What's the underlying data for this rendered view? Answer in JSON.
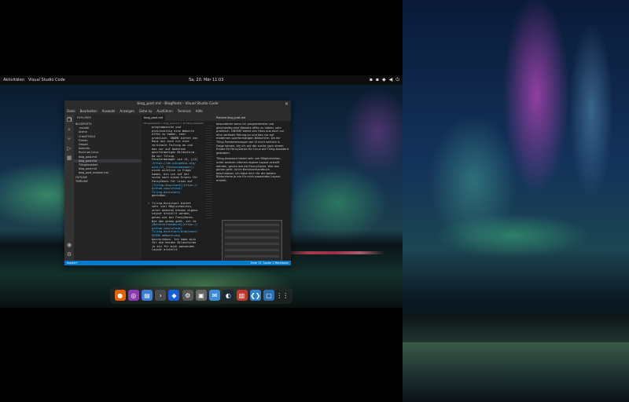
{
  "topbar": {
    "activities": "Aktivitäten",
    "app_name": "Visual Studio Code",
    "clock": "Sa, 20. Mär 11:03"
  },
  "window": {
    "title": "blog_post.md - BlogPosts - Visual Studio Code"
  },
  "menubar": [
    "Datei",
    "Bearbeiten",
    "Auswahl",
    "Anzeigen",
    "Gehe zu",
    "Ausführen",
    "Terminal",
    "Hilfe"
  ],
  "sidebar": {
    "title": "EXPLORER",
    "items": [
      {
        "label": "BLOGPOSTS",
        "selected": false
      },
      {
        "label": ".vscode",
        "selected": false
      },
      {
        "label": "Anime",
        "selected": false
      },
      {
        "label": "CrashTOOLS",
        "selected": false
      },
      {
        "label": "Firmen",
        "selected": false
      },
      {
        "label": "Gaspel",
        "selected": false
      },
      {
        "label": "Kubuntu",
        "selected": false
      },
      {
        "label": "Rund um Linux",
        "selected": false
      },
      {
        "label": "blog_post.md",
        "selected": false
      },
      {
        "label": "blog_post.md",
        "selected": true
      },
      {
        "label": "TilingAssistant",
        "selected": false
      },
      {
        "label": "blog_post.md",
        "selected": false
      },
      {
        "label": "blog_post_modern.md",
        "selected": false
      },
      {
        "label": "OUTLINE",
        "selected": false
      },
      {
        "label": "TIMELINE",
        "selected": false
      }
    ]
  },
  "editor": {
    "tab": "blog_post.md",
    "breadcrumb": "Tilingassistant > blog_post.md > # Tiling-Assistant",
    "lines": [
      {
        "n": "",
        "text": "programmieren und",
        "link": false
      },
      {
        "n": "",
        "text": "gleichzeitig eine Website",
        "link": false
      },
      {
        "n": "",
        "text": "offen zu haben, sehr",
        "link": false
      },
      {
        "n": "",
        "text": "praktisch. GNOME bietet von",
        "link": false
      },
      {
        "n": "",
        "text": "Haus aus auch nur eine",
        "link": false
      },
      {
        "n": "",
        "text": "vertikale Teilung an und",
        "link": false
      },
      {
        "n": "",
        "text": "das nur auf modernen",
        "link": false
      },
      {
        "n": "",
        "text": "querformatigen Bildschirm.",
        "link": false
      },
      {
        "n": "",
        "text": "Da mir Tiling",
        "link": false
      },
      {
        "n": "",
        "text": "Fenstermanager wie i3, [i3]",
        "link": false
      },
      {
        "n": "",
        "text": "(https://de.wikipedia.org/",
        "link": true
      },
      {
        "n": "",
        "text": "wiki/I3_(Fenstermanager))",
        "link": true
      },
      {
        "n": "",
        "text": "nicht wirklich in Frage",
        "link": false
      },
      {
        "n": "",
        "text": "kamen, bin ich auf der",
        "link": false
      },
      {
        "n": "",
        "text": "suche nach einem Ersatz für",
        "link": false
      },
      {
        "n": "",
        "text": "FancyZones für Linux auf",
        "link": false
      },
      {
        "n": "",
        "text": "[Tiling-Assistant](https://",
        "link": true
      },
      {
        "n": "",
        "text": "github.com/Leleat/",
        "link": true
      },
      {
        "n": "",
        "text": "Tiling-Assistant)",
        "link": true
      },
      {
        "n": "",
        "text": "gestoßen.",
        "link": false
      },
      {
        "n": "",
        "text": "",
        "link": false
      },
      {
        "n": "5",
        "text": "Tiling-Assistant bietet",
        "link": false
      },
      {
        "n": "",
        "text": "sehr viel Möglichkeiten,",
        "link": false
      },
      {
        "n": "",
        "text": "unter anderen können eigene",
        "link": false
      },
      {
        "n": "",
        "text": "Layout erstellt werden,",
        "link": false
      },
      {
        "n": "",
        "text": "genau wie bei FancyZones.",
        "link": false
      },
      {
        "n": "",
        "text": "Wie das genau geht, ist im",
        "link": false
      },
      {
        "n": "",
        "text": "[Benutzerhandbuch](https://",
        "link": true
      },
      {
        "n": "",
        "text": "github.com/Leleat/",
        "link": true
      },
      {
        "n": "",
        "text": "Tiling-Assistant/blob/main/",
        "link": true
      },
      {
        "n": "",
        "text": "GUIDE.md#preview)",
        "link": true
      },
      {
        "n": "",
        "text": "beschrieben. Ich habe mich",
        "link": false
      },
      {
        "n": "",
        "text": "für die beiden Bildschirme",
        "link": false
      },
      {
        "n": "",
        "text": "je ein für mich passendes",
        "link": false
      },
      {
        "n": "",
        "text": "Layout erstellt.",
        "link": false
      }
    ]
  },
  "preview": {
    "tab": "Preview blog_post.md",
    "paragraphs": [
      "besonderen wenn ich programmiere und gleichzeitig eine Website offen zu haben, sehr praktisch. GNOME bietet von Haus aus auch nur eine vertikale Teilung an und das nur auf modernen querformatigen Bildschirm. Da mir Tiling Fenstermanager wie i3 nicht wirklich in Frage kamen, bin ich auf der suche nach einem Ersatz für FancyZones für Linux auf Tiling-Assistant gestoßen.",
      "Tiling-Assistant bietet sehr viel Möglichkeiten, unter anderen können eigene Layout erstellt werden, genau wie bei FancyZones. Wie das genau geht, ist im Benutzerhandbuch beschrieben. Ich habe mich für die beiden Bildschirme je ein für mich passendes Layout erstellt."
    ]
  },
  "statusbar": {
    "left": "master*",
    "right": "Zeile 15, Spalte 1   Markdown"
  },
  "dock": {
    "icons": [
      "firefox-icon",
      "podcast-icon",
      "files-icon",
      "terminal-icon",
      "bitwarden-icon",
      "settings-icon",
      "screenshot-icon",
      "chat-icon",
      "steam-icon",
      "archive-icon",
      "vscode-icon",
      "virtualbox-icon",
      "app-grid-icon"
    ]
  }
}
